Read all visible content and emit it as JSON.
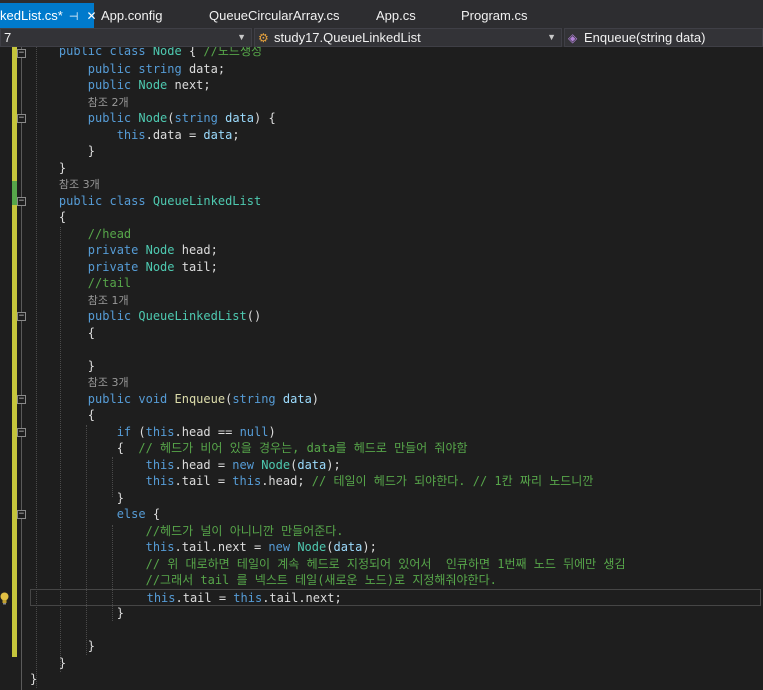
{
  "tabs": [
    {
      "label": "kedList.cs*",
      "active": true
    },
    {
      "label": "App.config"
    },
    {
      "label": "QueueCircularArray.cs"
    },
    {
      "label": "App.cs"
    },
    {
      "label": "Program.cs"
    }
  ],
  "tab_pin_glyph": "⊣",
  "tab_close_glyph": "✕",
  "nav": {
    "project": "7",
    "class": "study17.QueueLinkedList",
    "member": "Enqueue(string data)"
  },
  "code": [
    [
      "public class Node { //노드생성"
    ],
    [
      "public string data;"
    ],
    [
      "public Node next;"
    ],
    [
      "참조 2개"
    ],
    [
      "public Node(string data) {"
    ],
    [
      "this.data = data;"
    ],
    [
      "}"
    ],
    [
      "}"
    ],
    [
      "참조 3개"
    ],
    [
      "public class QueueLinkedList"
    ],
    [
      "{"
    ],
    [
      "//head"
    ],
    [
      "private Node head;"
    ],
    [
      "private Node tail;"
    ],
    [
      "//tail"
    ],
    [
      "참조 1개"
    ],
    [
      "public QueueLinkedList()"
    ],
    [
      "{"
    ],
    [
      ""
    ],
    [
      "}"
    ],
    [
      "참조 3개"
    ],
    [
      "public void Enqueue(string data)"
    ],
    [
      "{"
    ],
    [
      "if (this.head == null)"
    ],
    [
      "{  // 헤드가 비어 있을 경우는, data를 헤드로 만들어 줘야함"
    ],
    [
      "this.head = new Node(data);"
    ],
    [
      "this.tail = this.head; // 테일이 헤드가 되야한다. // 1칸 짜리 노드니깐"
    ],
    [
      "}"
    ],
    [
      "else {"
    ],
    [
      "//헤드가 널이 아니니깐 만들어준다."
    ],
    [
      "this.tail.next = new Node(data);"
    ],
    [
      "// 위 대로하면 테일이 계속 헤드로 지정되어 있어서  인큐하면 1번째 노드 뒤에만 생김"
    ],
    [
      "//그래서 tail 를 넥스트 테일(새로운 노드)로 지정해줘야한다."
    ],
    [
      "this.tail = this.tail.next;"
    ],
    [
      "}"
    ],
    [
      ""
    ],
    [
      "}"
    ],
    [
      "}"
    ],
    [
      "}"
    ]
  ],
  "colors": {
    "keyword": "#569cd6",
    "type": "#4ec9b0",
    "comment": "#57a64a",
    "method": "#dcdcaa",
    "parameter": "#9cdcfe",
    "reference_lens": "#999999",
    "active_tab": "#007acc"
  }
}
